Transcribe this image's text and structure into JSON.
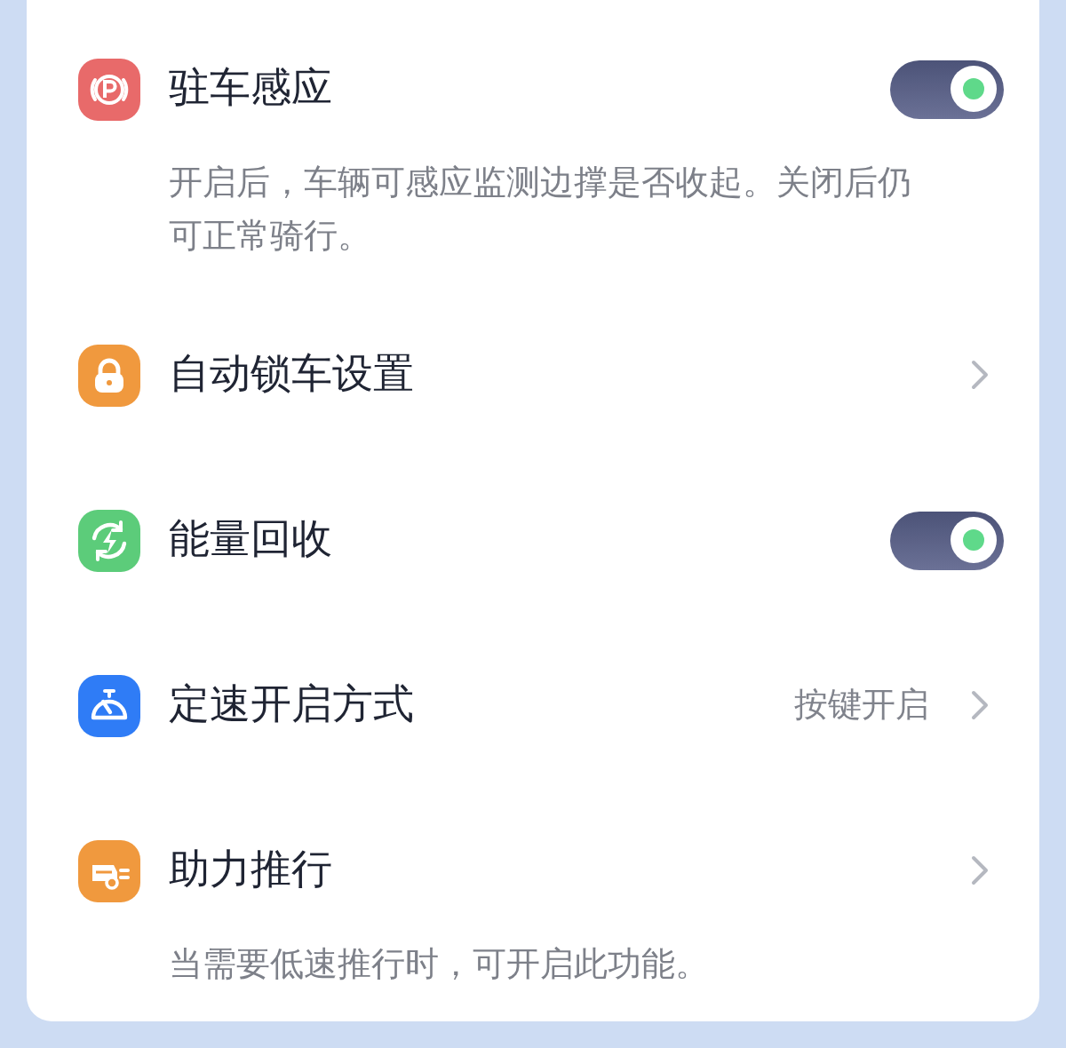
{
  "settings": [
    {
      "kind": "toggle",
      "title": "驻车感应",
      "on": true,
      "description": "开启后，车辆可感应监测边撑是否收起。关闭后仍可正常骑行。"
    },
    {
      "kind": "link",
      "title": "自动锁车设置"
    },
    {
      "kind": "toggle",
      "title": "能量回收",
      "on": true
    },
    {
      "kind": "link",
      "title": "定速开启方式",
      "value": "按键开启"
    },
    {
      "kind": "link",
      "title": "助力推行",
      "description": "当需要低速推行时，可开启此功能。"
    }
  ]
}
